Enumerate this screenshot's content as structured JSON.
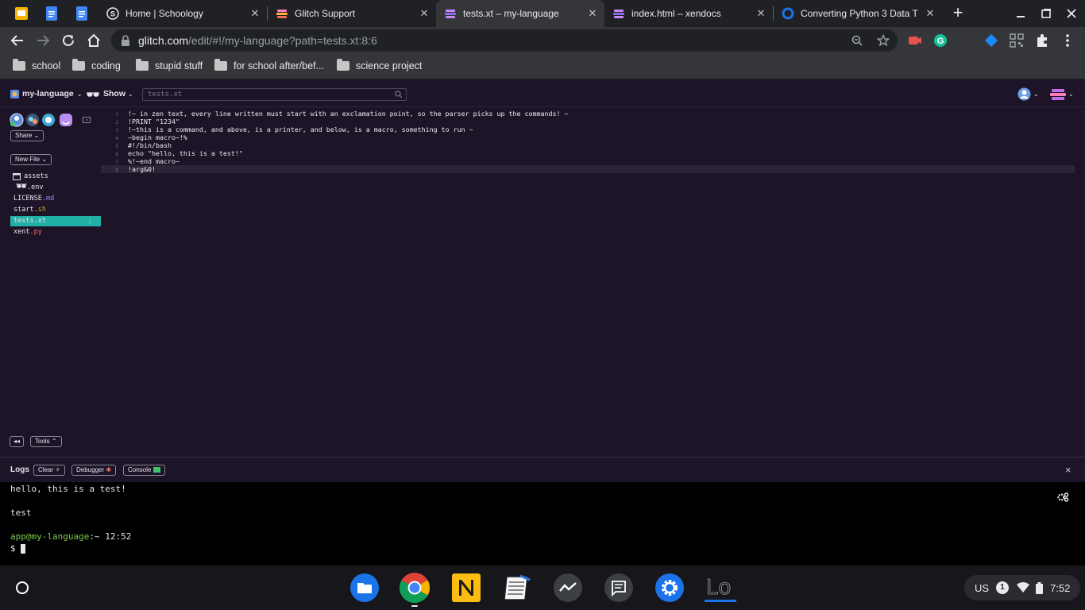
{
  "tabs": [
    {
      "title": "Home | Schoology",
      "close": "✕"
    },
    {
      "title": "Glitch Support",
      "close": "✕"
    },
    {
      "title": "tests.xt – my-language",
      "close": "✕"
    },
    {
      "title": "index.html – xendocs",
      "close": "✕"
    },
    {
      "title": "Converting Python 3 Data T",
      "close": "✕"
    }
  ],
  "new_tab": "+",
  "address": {
    "host": "glitch.com",
    "path": "/edit/#!/my-language?path=tests.xt:8:6"
  },
  "bookmarks": [
    "school",
    "coding",
    "stupid stuff",
    "for school after/bef...",
    "science project"
  ],
  "glitch": {
    "project_name": "my-language",
    "show_label": "Show",
    "search_placeholder": "tests.xt",
    "share_label": "Share",
    "new_file_label": "New File",
    "assets_label": "assets",
    "files": [
      {
        "base": ".env",
        "ext": ""
      },
      {
        "base": "LICENSE",
        "ext": ".md"
      },
      {
        "base": "start",
        "ext": ".sh"
      },
      {
        "base": "tests",
        "ext": ".xt"
      },
      {
        "base": "xent",
        "ext": ".py"
      }
    ],
    "tools_label": "Tools"
  },
  "editor_lines": [
    {
      "n": "1",
      "text": "!~ in zen text, every line written must start with an exclamation point, so the parser picks up the commands! ~"
    },
    {
      "n": "2",
      "text": "!PRINT \"1234\""
    },
    {
      "n": "3",
      "text": "!~this is a command, and above, is a printer, and below, is a macro, something to run ~"
    },
    {
      "n": "4",
      "text": "~begin macro~!%"
    },
    {
      "n": "5",
      "text": "#!/bin/bash"
    },
    {
      "n": "6",
      "text": "echo \"hello, this is a test!\""
    },
    {
      "n": "7",
      "text": "%!~end macro~"
    },
    {
      "n": "8",
      "text": "!arg&0!"
    }
  ],
  "logs": {
    "title": "Logs",
    "clear_label": "Clear",
    "debugger_label": "Debugger",
    "console_label": "Console",
    "close": "×"
  },
  "terminal": {
    "line1": "hello, this is a test!",
    "line2": "test",
    "prompt_user": "app@my-language",
    "prompt_rest": ":~ 12:52",
    "prompt_symbol": "$"
  },
  "tray": {
    "locale": "US",
    "notifications": "1",
    "time": "7:52"
  },
  "colors": {
    "accent": "#21b0a5",
    "prompt": "#7ec850",
    "background": "#1d1527"
  }
}
